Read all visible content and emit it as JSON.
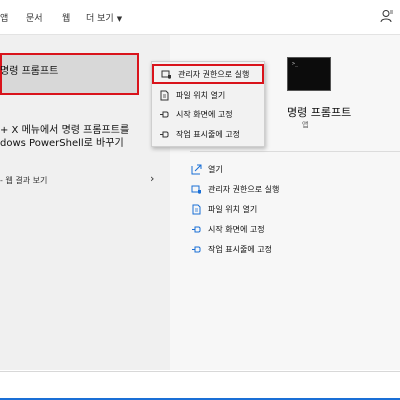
{
  "tabs": [
    {
      "label": "앱"
    },
    {
      "label": "문서"
    },
    {
      "label": "웹"
    },
    {
      "label": "더 보기"
    }
  ],
  "left": {
    "best_match_title": "명령 프롬프트",
    "tip_line1": "+ X 메뉴에서 명령 프롬프트를",
    "tip_line2": "dows PowerShell로 바꾸기",
    "web_results": "- 웹 결과 보기"
  },
  "context_menu": {
    "items": [
      {
        "label": "관리자 권한으로 실행",
        "icon": "shield-admin-icon"
      },
      {
        "label": "파일 위치 열기",
        "icon": "file-location-icon"
      },
      {
        "label": "시작 화면에 고정",
        "icon": "pin-icon"
      },
      {
        "label": "작업 표시줄에 고정",
        "icon": "pin-icon"
      }
    ]
  },
  "right": {
    "app_name": "명령 프롬프트",
    "app_type": "앱",
    "actions": [
      {
        "label": "열기",
        "icon": "open-icon"
      },
      {
        "label": "관리자 권한으로 실행",
        "icon": "shield-admin-icon"
      },
      {
        "label": "파일 위치 열기",
        "icon": "file-location-icon"
      },
      {
        "label": "시작 화면에 고정",
        "icon": "pin-icon"
      },
      {
        "label": "작업 표시줄에 고정",
        "icon": "pin-icon"
      }
    ]
  },
  "colors": {
    "highlight_border": "#d9131b",
    "icon_blue": "#1a6fd6",
    "selected_bg": "#d8d8d8"
  }
}
